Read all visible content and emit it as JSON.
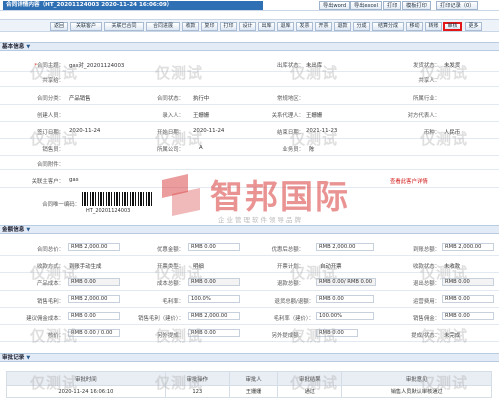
{
  "header": {
    "title": "合同详情内容（HT_20201124003    2020-11-24 16:06:09）",
    "buttons": [
      "导出word",
      "导出excel",
      "打印",
      "模板打印",
      "打印记录（0）"
    ]
  },
  "toolbar": {
    "buttons": [
      "返回",
      "关联客户",
      "关联已合同",
      "合同进展",
      "收款",
      "复印",
      "打印",
      "设计",
      "出库",
      "退库",
      "发票",
      "开票",
      "退款",
      "分成",
      "结算分成",
      "移动",
      "转账",
      "审核",
      "更多"
    ],
    "highlighted": "审核"
  },
  "basic": {
    "section_title": "基本信息",
    "rows": [
      [
        {
          "label": "合同主题：",
          "value": "gas对_20201124003"
        },
        {
          "label": "出库状态：",
          "value": "未出库"
        },
        {
          "label": "发货状态：",
          "value": "未发货"
        }
      ],
      [
        {
          "label": "共享给：",
          "value": ""
        },
        {
          "label": "",
          "value": ""
        },
        {
          "label": "共享人：",
          "value": ""
        }
      ],
      [
        {
          "label": "合同分类：",
          "value": "产品销售"
        },
        {
          "label": "合同状态：",
          "value": "执行中"
        },
        {
          "label": "常规地区：",
          "value": ""
        },
        {
          "label": "所属行业：",
          "value": ""
        }
      ],
      [
        {
          "label": "创建人员：",
          "value": ""
        },
        {
          "label": "录入人：",
          "value": "王姗姗"
        },
        {
          "label": "关系代理人：",
          "value": "王姗姗"
        },
        {
          "label": "对方代表人：",
          "value": ""
        }
      ],
      [
        {
          "label": "签订日期：",
          "value": "2020-11-24"
        },
        {
          "label": "开始日期：",
          "value": "2020-11-24"
        },
        {
          "label": "结束日期：",
          "value": "2021-11-23"
        },
        {
          "label": "币种：",
          "value": "人民币"
        }
      ],
      [
        {
          "label": "销售员：",
          "value": ""
        },
        {
          "label": "所属公司：",
          "value": "A"
        },
        {
          "label": "业务员：",
          "value": "陈"
        }
      ],
      [
        {
          "label": "合同附件：",
          "value": ""
        }
      ],
      [
        {
          "label": "关联主客户：",
          "value": "gas"
        },
        {
          "label": "",
          "value": ""
        },
        {
          "label": "",
          "value": "查看此客户详情"
        }
      ]
    ],
    "barcode_label": "合同唯一编码：",
    "barcode_value": "HT_20201124003"
  },
  "amount": {
    "section_title": "金额信息",
    "rows": [
      [
        {
          "label": "合同总价：",
          "value": "RMB 2,000.00"
        },
        {
          "label": "优惠金额：",
          "value": "RMB 0.00"
        },
        {
          "label": "优惠后总额：",
          "value": "RMB 2,000.00"
        },
        {
          "label": "到账总额：",
          "value": "RMB 2,000.00"
        }
      ],
      [
        {
          "label": "收款方式：",
          "value": "到账手动生成"
        },
        {
          "label": "开票类型：",
          "value": "明细"
        },
        {
          "label": "开票计划：",
          "value": "自动开票"
        },
        {
          "label": "收款状态：",
          "value": "未收款"
        }
      ],
      [
        {
          "label": "产品成本：",
          "value": "RMB 0.00"
        },
        {
          "label": "成本总额：",
          "value": "RMB 0.00"
        },
        {
          "label": "退款总额：",
          "value": "RMB 0.00/ RMB 0.00"
        },
        {
          "label": "退出总额：",
          "value": "RMB 0.00"
        }
      ],
      [
        {
          "label": "销售毛利：",
          "value": "RMB 2,000.00"
        },
        {
          "label": "毛利率：",
          "value": "100.0%"
        },
        {
          "label": "退货总额/退额：",
          "value": "RMB 0.00"
        },
        {
          "label": "运营费用：",
          "value": "RMB 0.00"
        }
      ],
      [
        {
          "label": "建议佣金成本：",
          "value": "RMB 0.00"
        },
        {
          "label": "销售毛利（建价）：",
          "value": "RMB 2,000.00"
        },
        {
          "label": "毛利率（建价）：",
          "value": "100.00%"
        },
        {
          "label": "销售佣金：",
          "value": "RMB 0.00"
        }
      ],
      [
        {
          "label": "核价：",
          "value": "RMB 0.00 / 0.00"
        },
        {
          "label": "另外提成：",
          "value": "RMB 0.00"
        },
        {
          "label": "另外提成额：",
          "value": "RMB 0.00"
        },
        {
          "label": "提成/状态：",
          "value": "未完成"
        }
      ]
    ]
  },
  "approval": {
    "section_title": "审批记录",
    "columns": [
      "审批时间",
      "审批操作",
      "审批人",
      "审批结果",
      "审批意见"
    ],
    "rows": [
      [
        "2020-11-24 16:06:10",
        "123",
        "王姗姗",
        "通过",
        "销售人员默认审核通过"
      ]
    ]
  },
  "watermark_text": "仅测试",
  "logo": {
    "name": "智邦国际",
    "tagline": "企业管理软件领导品牌"
  },
  "colors": {
    "accent": "#2f6fb3",
    "highlight": "#e21818",
    "section_bg": "#e3ecf6"
  }
}
